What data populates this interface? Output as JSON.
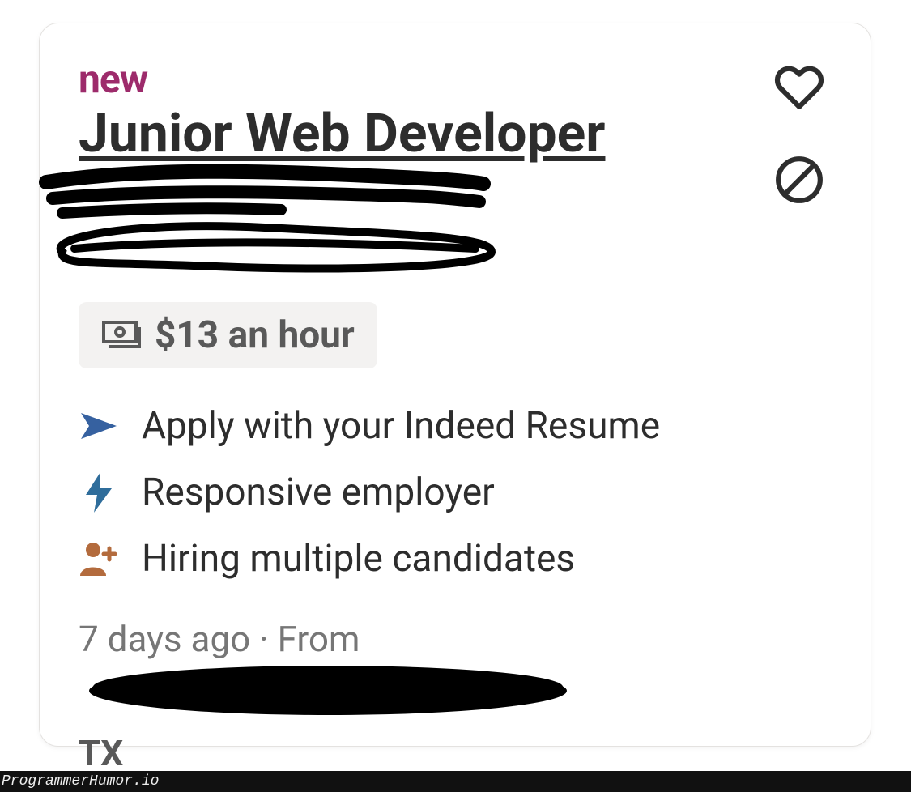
{
  "badge": "new",
  "title": "Junior Web Developer",
  "salary": "$13 an hour",
  "features": [
    "Apply with your Indeed Resume",
    "Responsive employer",
    "Hiring multiple candidates"
  ],
  "footer": {
    "posted": "7 days ago",
    "separator": " · ",
    "from_label": "From",
    "location_suffix": "TX"
  },
  "watermark": "ProgrammerHumor.io"
}
